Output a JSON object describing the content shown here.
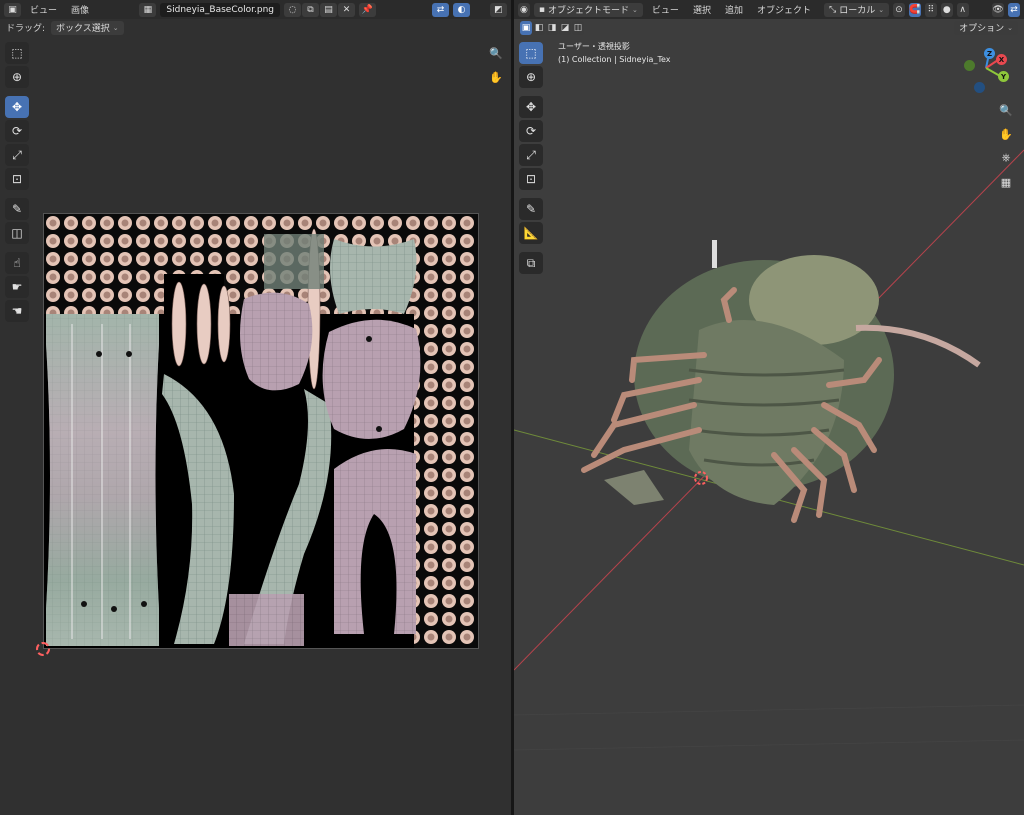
{
  "uv_editor": {
    "header": {
      "menus": [
        "ビュー",
        "画像"
      ],
      "image_name": "Sidneyia_BaseColor.png"
    },
    "subheader": {
      "drag_label": "ドラッグ:",
      "drag_mode": "ボックス選択"
    }
  },
  "viewport": {
    "header": {
      "mode": "オブジェクトモード",
      "menus": [
        "ビュー",
        "選択",
        "追加",
        "オブジェクト"
      ],
      "orientation": "ローカル"
    },
    "options_label": "オプション",
    "view_name": "ユーザー・透視投影",
    "collection_info": "(1) Collection | Sidneyia_Tex",
    "gizmo": {
      "x": "X",
      "y": "Y",
      "z": "Z"
    }
  },
  "colors": {
    "accent": "#4772b3",
    "axis_x": "#e8484f",
    "axis_y": "#8ec73b",
    "axis_z": "#3d8fe0"
  }
}
